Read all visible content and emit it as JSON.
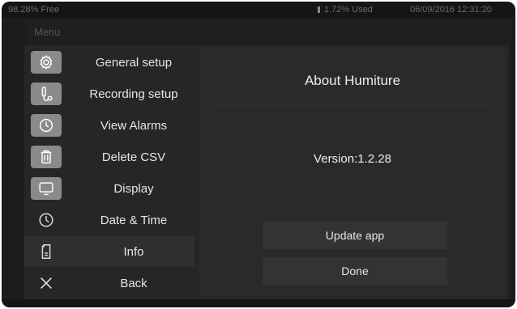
{
  "status_bar": {
    "free": "98.28% Free",
    "used": "1.72% Used",
    "datetime": "06/09/2016 12:31:20"
  },
  "menu": {
    "title": "Menu",
    "items": [
      {
        "label": "General setup",
        "icon": "gear-icon"
      },
      {
        "label": "Recording setup",
        "icon": "probe-icon"
      },
      {
        "label": "View Alarms",
        "icon": "alarm-clock-icon"
      },
      {
        "label": "Delete CSV",
        "icon": "trash-icon"
      },
      {
        "label": "Display",
        "icon": "monitor-icon"
      },
      {
        "label": "Date & Time",
        "icon": "clock-icon"
      },
      {
        "label": "Info",
        "icon": "document-icon",
        "selected": true
      },
      {
        "label": "Back",
        "icon": "close-icon"
      }
    ]
  },
  "panel": {
    "title": "About Humiture",
    "version": "Version:1.2.28",
    "update_button": "Update app",
    "done_button": "Done"
  },
  "colors": {
    "background": "#1c1c1c",
    "dialog": "#262626",
    "icon_tile": "#8a8a8a",
    "text": "#e6e6e6"
  }
}
